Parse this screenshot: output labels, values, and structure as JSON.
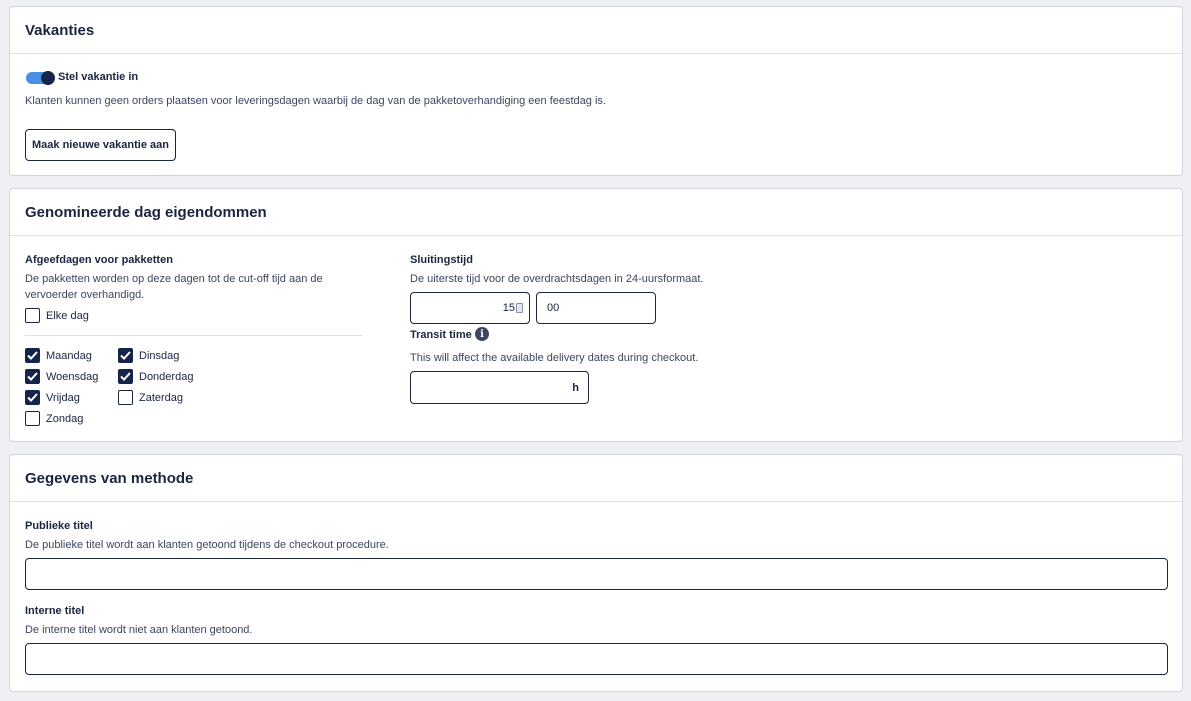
{
  "vacations": {
    "title": "Vakanties",
    "toggle_label": "Stel vakantie in",
    "toggle_on": true,
    "description": "Klanten kunnen geen orders plaatsen voor leveringsdagen waarbij de dag van de pakketoverhandiging een feestdag is.",
    "create_button": "Maak nieuwe vakantie aan"
  },
  "day_properties": {
    "title": "Genomineerde dag eigendommen",
    "handover": {
      "label": "Afgeefdagen voor pakketten",
      "description": "De pakketten worden op deze dagen tot de cut-off tijd aan de vervoerder overhandigd.",
      "every_day": {
        "label": "Elke dag",
        "checked": false
      },
      "days": [
        {
          "label": "Maandag",
          "checked": true
        },
        {
          "label": "Dinsdag",
          "checked": true
        },
        {
          "label": "Woensdag",
          "checked": true
        },
        {
          "label": "Donderdag",
          "checked": true
        },
        {
          "label": "Vrijdag",
          "checked": true
        },
        {
          "label": "Zaterdag",
          "checked": false
        },
        {
          "label": "Zondag",
          "checked": false
        }
      ]
    },
    "closing_time": {
      "label": "Sluitingstijd",
      "description": "De uiterste tijd voor de overdrachtsdagen in 24-uursformaat.",
      "hours_value": "15",
      "minutes_value": "00"
    },
    "transit_time": {
      "label": "Transit time",
      "info_icon": "i",
      "description": "This will affect the available delivery dates during checkout.",
      "value": "",
      "unit": "h"
    }
  },
  "method_details": {
    "title": "Gegevens van methode",
    "public_title": {
      "label": "Publieke titel",
      "description": "De publieke titel wordt aan klanten getoond tijdens de checkout procedure.",
      "value": ""
    },
    "internal_title": {
      "label": "Interne titel",
      "description": "De interne titel wordt niet aan klanten getoond.",
      "value": ""
    }
  }
}
